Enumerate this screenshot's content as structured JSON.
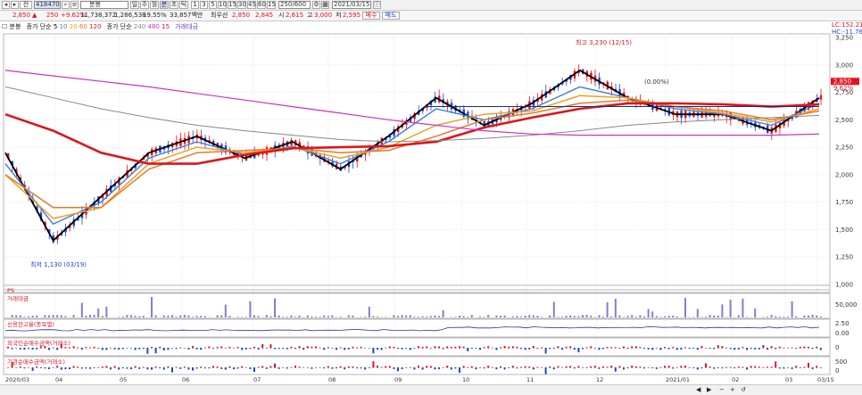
{
  "toolbar": {
    "code": "418470",
    "name_placeholder": "",
    "period_label": "분봉",
    "period_buttons": [
      "일",
      "주",
      "월",
      "분",
      "초",
      "틱"
    ],
    "interval_buttons": [
      "1",
      "3",
      "5",
      "10",
      "15",
      "30",
      "45",
      "60"
    ],
    "extra_button": "15",
    "count_field": "250/600",
    "date_field": "2021/03/15",
    "icons": [
      "chevron-left-icon",
      "chevron-right-icon",
      "menu-icon",
      "search-icon",
      "calendar-icon",
      "settings-icon",
      "info-icon"
    ]
  },
  "quote": {
    "price": "2,850",
    "direction": "▲",
    "change": "250",
    "change_pct": "+9.62%",
    "volume": "11,738,372",
    "volume_pct": "1,286,538",
    "vol_ratio": "19.55%",
    "trade_amount": "33,857백만",
    "prev_label": "최우선",
    "ask": "2,850",
    "bid": "2,845",
    "open_label": "시",
    "open": "2,615",
    "high_label": "고",
    "high": "3,000",
    "low_label": "저",
    "low": "2,595",
    "buy_button": "매수",
    "sell_button": "매도"
  },
  "legend": {
    "price_label": "분봉",
    "ma_label": "종가 단순",
    "ma_periods": [
      "5",
      "10",
      "20",
      "60",
      "120"
    ],
    "ma2_label": "종가 단순",
    "ma2_periods": [
      "240",
      "480",
      "15"
    ],
    "vol_label": "거래대금"
  },
  "annotations": {
    "high": "최고 3,230 (12/15)",
    "low": "최저 1,130 (03/19)",
    "pct_label": "(0.00%)"
  },
  "right_axis": {
    "info1": "LC:152.21",
    "info2": "HC:-11.76",
    "price_ticks": [
      "3,250",
      "3,000",
      "2,750",
      "2,500",
      "2,250",
      "2,000",
      "1,750",
      "1,500",
      "1,250",
      "1,000"
    ],
    "price_tag": "2,850",
    "price_tag2": "9.62%",
    "vol_ticks": [
      "50,000"
    ],
    "ind1_ticks": [
      "2.50",
      "0.00"
    ],
    "ind2_ticks": [
      "500",
      "0"
    ],
    "ind3_ticks": [
      "500",
      "0"
    ]
  },
  "panels": {
    "panel0_label": "PS",
    "panel1_label": "거래대금",
    "panel2_label": "신용잔고율(종목별)",
    "panel3_label": "외국인순매수금액(거래소)",
    "panel4_label": "기관순매수금액(거래소)"
  },
  "time_axis": [
    "2020/03",
    "04",
    "05",
    "06",
    "07",
    "08",
    "09",
    "10",
    "11",
    "12",
    "2021/01",
    "02",
    "03",
    "03/15"
  ],
  "colors": {
    "up": "#e0141e",
    "down": "#1848d8",
    "ma5": "#000000",
    "ma10": "#3c7de0",
    "ma20": "#f0a020",
    "ma60": "#e8782a",
    "ma120": "#e01418",
    "ma240": "#888888",
    "ma480": "#d030c0"
  },
  "chart_data": {
    "type": "line",
    "title": "",
    "x": [
      "2020/03",
      "04",
      "05",
      "06",
      "07",
      "08",
      "09",
      "10",
      "11",
      "12",
      "2021/01",
      "02",
      "03",
      "03/15"
    ],
    "ylim": [
      1000,
      3250
    ],
    "series": [
      {
        "name": "5",
        "values": [
          2200,
          1400,
          1800,
          2200,
          2350,
          2150,
          2300,
          2050,
          2350,
          2700,
          2450,
          2650,
          2950,
          2700,
          2550,
          2550,
          2400,
          2700
        ]
      },
      {
        "name": "10",
        "values": [
          2100,
          1550,
          1750,
          2150,
          2300,
          2180,
          2260,
          2100,
          2300,
          2600,
          2500,
          2600,
          2800,
          2700,
          2600,
          2550,
          2450,
          2650
        ]
      },
      {
        "name": "20",
        "values": [
          2000,
          1600,
          1700,
          2100,
          2250,
          2200,
          2250,
          2150,
          2250,
          2450,
          2550,
          2580,
          2720,
          2700,
          2620,
          2560,
          2480,
          2600
        ]
      },
      {
        "name": "60",
        "values": [
          2000,
          1700,
          1700,
          2050,
          2200,
          2220,
          2240,
          2200,
          2220,
          2350,
          2500,
          2560,
          2650,
          2680,
          2620,
          2580,
          2500,
          2580
        ]
      },
      {
        "name": "120",
        "values": [
          2550,
          2400,
          2200,
          2100,
          2100,
          2180,
          2240,
          2250,
          2260,
          2300,
          2430,
          2520,
          2600,
          2650,
          2650,
          2640,
          2620,
          2640
        ]
      },
      {
        "name": "240",
        "values": [
          2800,
          2700,
          2600,
          2520,
          2450,
          2400,
          2360,
          2320,
          2300,
          2310,
          2330,
          2360,
          2400,
          2450,
          2480,
          2500,
          2520,
          2540
        ]
      },
      {
        "name": "480",
        "values": [
          2950,
          2900,
          2850,
          2800,
          2740,
          2680,
          2620,
          2560,
          2500,
          2450,
          2400,
          2370,
          2360,
          2360,
          2360,
          2360,
          2360,
          2370
        ]
      }
    ],
    "annotations": [
      "최고 3,230 (12/15)",
      "최저 1,130 (03/19)"
    ]
  }
}
